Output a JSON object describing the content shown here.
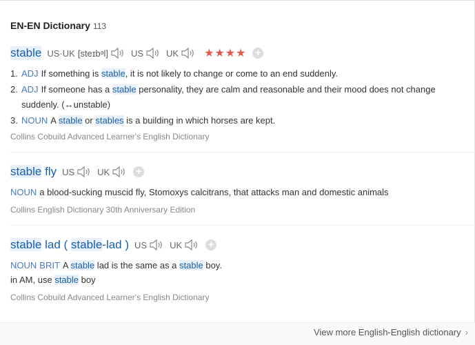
{
  "header": {
    "title": "EN-EN Dictionary",
    "count": "113"
  },
  "entry1": {
    "headword": "stable",
    "pron_label": "US·UK",
    "ipa": "[steɪbᵊl]",
    "us_label": "US",
    "uk_label": "UK",
    "stars": "★★★★",
    "defs": [
      {
        "num": "1.",
        "pos": "ADJ",
        "parts": [
          "If something is ",
          "stable",
          ", it is not likely to change or come to an end suddenly."
        ]
      },
      {
        "num": "2.",
        "pos": "ADJ",
        "parts": [
          "If someone has a ",
          "stable",
          " personality, they are calm and reasonable and their mood does not change suddenly. (↔unstable)"
        ]
      },
      {
        "num": "3.",
        "pos": "NOUN",
        "parts": [
          "A ",
          "stable",
          " or ",
          "stables",
          " is a building in which horses are kept."
        ]
      }
    ],
    "source": "Collins Cobuild Advanced Learner's English Dictionary"
  },
  "entry2": {
    "headword_hl": "stable",
    "headword_rest": " fly",
    "us_label": "US",
    "uk_label": "UK",
    "pos": "NOUN",
    "def": "a blood-sucking muscid fly, Stomoxys calcitrans, that attacks man and domestic animals",
    "source": "Collins English Dictionary 30th Anniversary Edition"
  },
  "entry3": {
    "hw_a": "stable",
    "hw_b": " lad ( ",
    "hw_c": "stable",
    "hw_d": "-lad )",
    "us_label": "US",
    "uk_label": "UK",
    "pos": "NOUN",
    "region": "BRIT",
    "line1": [
      "A ",
      "stable",
      " lad is the same as a ",
      "stable",
      " boy."
    ],
    "line2": [
      "in AM, use ",
      "stable",
      " boy"
    ],
    "source": "Collins Cobuild Advanced Learner's English Dictionary"
  },
  "footer": {
    "more": "View more English-English dictionary",
    "chevron": "›"
  },
  "icons": {
    "speaker": "speaker-icon",
    "plus": "plus-icon"
  },
  "colors": {
    "headword": "#1a5fa8",
    "highlight": "#e8f0fb",
    "pos": "#4a79c2",
    "stars": "#e05a4a"
  }
}
